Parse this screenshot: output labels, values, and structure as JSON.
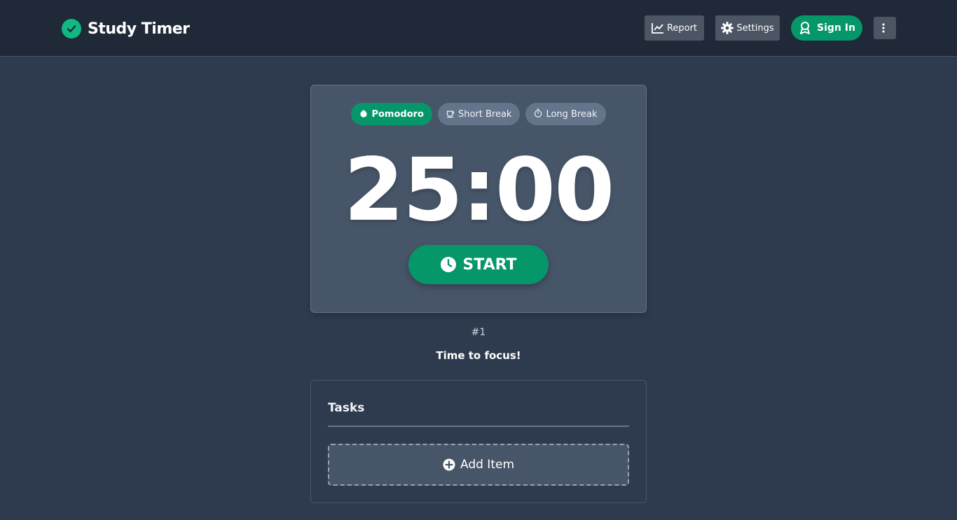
{
  "header": {
    "app_title": "Study Timer",
    "report_label": "Report",
    "settings_label": "Settings",
    "signin_label": "Sign In"
  },
  "timer": {
    "modes": [
      {
        "label": "Pomodoro",
        "icon": "tomato-icon",
        "active": true
      },
      {
        "label": "Short Break",
        "icon": "coffee-icon",
        "active": false
      },
      {
        "label": "Long Break",
        "icon": "stopwatch-icon",
        "active": false
      }
    ],
    "time": "25:00",
    "start_label": "START"
  },
  "session": {
    "count": "#1",
    "message": "Time to focus!"
  },
  "tasks": {
    "title": "Tasks",
    "add_label": "Add Item"
  },
  "colors": {
    "accent": "#059669",
    "background": "#2e3b4e",
    "card": "#475569"
  }
}
